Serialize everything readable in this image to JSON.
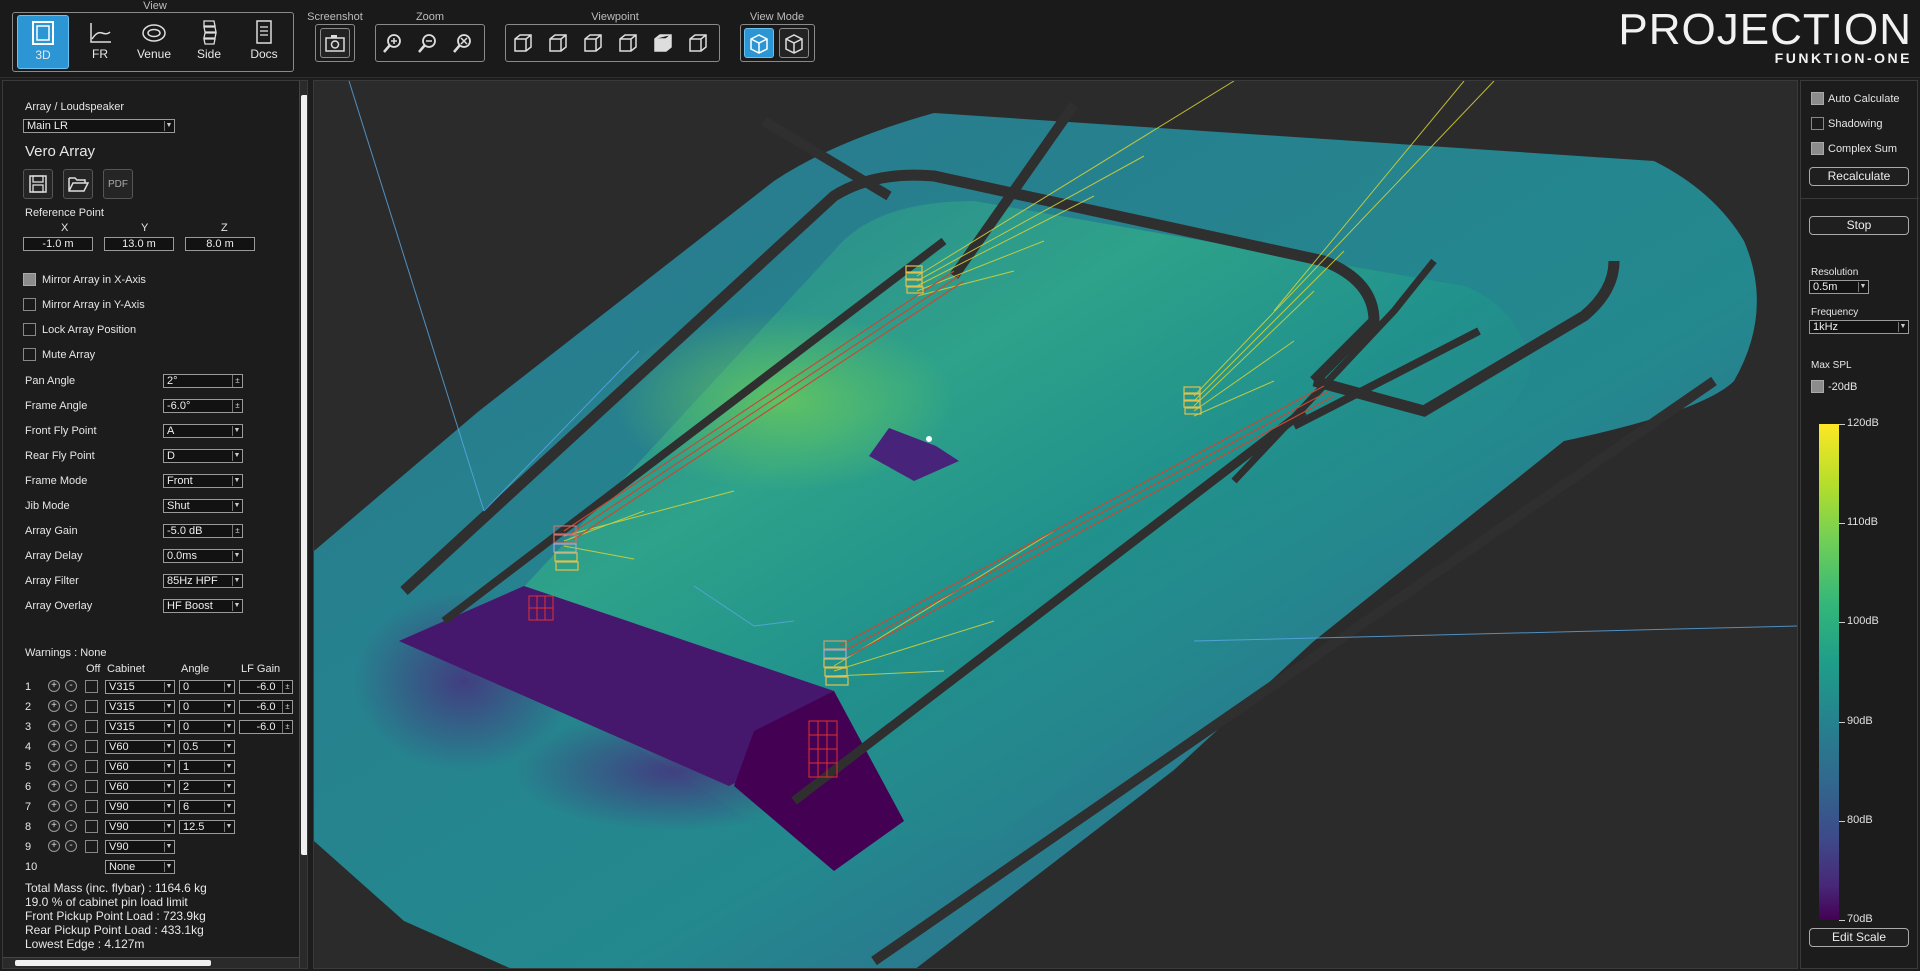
{
  "toolbar": {
    "groups": {
      "view": "View",
      "screenshot": "Screenshot",
      "zoom": "Zoom",
      "viewpoint": "Viewpoint",
      "view_mode": "View Mode"
    },
    "view_buttons": [
      "3D",
      "FR",
      "Venue",
      "Side",
      "Docs"
    ],
    "brand_title": "PROJECTION",
    "brand_subtitle": "FUNKTION-ONE"
  },
  "left": {
    "section_title": "Array / Loudspeaker",
    "array_select": "Main LR",
    "array_type": "Vero Array",
    "pdf_label": "PDF",
    "ref_point": {
      "label": "Reference Point",
      "x_label": "X",
      "y_label": "Y",
      "z_label": "Z",
      "x": "-1.0 m",
      "y": "13.0 m",
      "z": "8.0 m"
    },
    "checkboxes": [
      {
        "label": "Mirror Array in X-Axis",
        "checked": true
      },
      {
        "label": "Mirror Array in Y-Axis",
        "checked": false
      },
      {
        "label": "Lock Array Position",
        "checked": false
      },
      {
        "label": "Mute Array",
        "checked": false
      }
    ],
    "params": [
      {
        "label": "Pan Angle",
        "value": "2°"
      },
      {
        "label": "Frame Angle",
        "value": "-6.0°"
      },
      {
        "label": "Front Fly Point",
        "value": "A"
      },
      {
        "label": "Rear Fly Point",
        "value": "D"
      },
      {
        "label": "Frame Mode",
        "value": "Front"
      },
      {
        "label": "Jib Mode",
        "value": "Shut"
      },
      {
        "label": "Array Gain",
        "value": "-5.0 dB"
      },
      {
        "label": "Array Delay",
        "value": "0.0ms"
      },
      {
        "label": "Array Filter",
        "value": "85Hz HPF"
      },
      {
        "label": "Array Overlay",
        "value": "HF Boost"
      }
    ],
    "warnings": "Warnings : None",
    "cabinet_headers": {
      "off": "Off",
      "cabinet": "Cabinet",
      "angle": "Angle",
      "lf_gain": "LF Gain"
    },
    "cabinets": [
      {
        "n": "1",
        "cabinet": "V315",
        "angle": "0",
        "lf": "-6.0"
      },
      {
        "n": "2",
        "cabinet": "V315",
        "angle": "0",
        "lf": "-6.0"
      },
      {
        "n": "3",
        "cabinet": "V315",
        "angle": "0",
        "lf": "-6.0"
      },
      {
        "n": "4",
        "cabinet": "V60",
        "angle": "0.5",
        "lf": ""
      },
      {
        "n": "5",
        "cabinet": "V60",
        "angle": "1",
        "lf": ""
      },
      {
        "n": "6",
        "cabinet": "V60",
        "angle": "2",
        "lf": ""
      },
      {
        "n": "7",
        "cabinet": "V90",
        "angle": "6",
        "lf": ""
      },
      {
        "n": "8",
        "cabinet": "V90",
        "angle": "12.5",
        "lf": ""
      },
      {
        "n": "9",
        "cabinet": "V90",
        "angle": "",
        "lf": ""
      },
      {
        "n": "10",
        "cabinet": "None",
        "angle": "",
        "lf": ""
      }
    ],
    "info_lines": [
      "Total Mass (inc. flybar) : 1164.6 kg",
      "19.0 % of cabinet pin load limit",
      "Front Pickup Point Load : 723.9kg",
      "Rear Pickup Point Load : 433.1kg",
      "Lowest Edge : 4.127m"
    ]
  },
  "right": {
    "auto_calculate": "Auto Calculate",
    "shadowing": "Shadowing",
    "complex_sum": "Complex Sum",
    "recalculate": "Recalculate",
    "stop": "Stop",
    "resolution_label": "Resolution",
    "resolution": "0.5m",
    "frequency_label": "Frequency",
    "frequency": "1kHz",
    "max_spl_label": "Max SPL",
    "max_spl_value": "-20dB",
    "scale_labels": [
      "120dB",
      "110dB",
      "100dB",
      "90dB",
      "80dB",
      "70dB"
    ],
    "edit_scale": "Edit Scale"
  },
  "colors": {
    "accent": "#2c95d3",
    "spl_high": "#fde725",
    "spl_mid": "#21918c",
    "spl_low": "#440154",
    "walkway": "#2f2f2f"
  }
}
